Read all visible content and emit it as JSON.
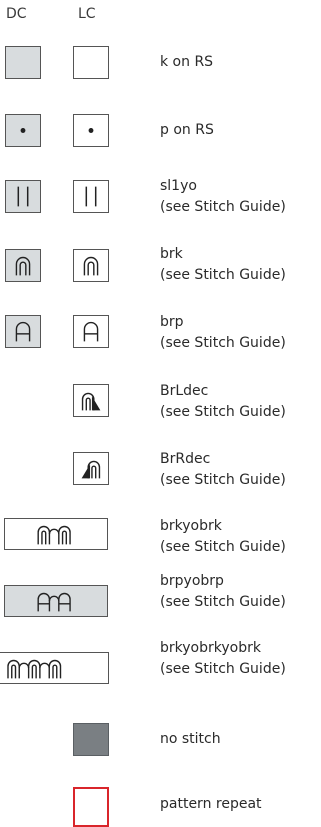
{
  "headers": {
    "dc": "DC",
    "lc": "LC"
  },
  "colors": {
    "dc_fill": "#d8dcde",
    "no_stitch": "#7a7f83",
    "repeat_border": "#d9252b",
    "stroke": "#555555"
  },
  "legend": [
    {
      "id": "k-on-rs",
      "icon": "blank-square-icon",
      "name": "k on RS",
      "note": ""
    },
    {
      "id": "p-on-rs",
      "icon": "dot-square-icon",
      "name": "p on RS",
      "note": ""
    },
    {
      "id": "sl1yo",
      "icon": "double-bar-icon",
      "name": "sl1yo",
      "note": "(see Stitch Guide)"
    },
    {
      "id": "brk",
      "icon": "arch-up-icon",
      "name": "brk",
      "note": "(see Stitch Guide)"
    },
    {
      "id": "brp",
      "icon": "arch-bar-icon",
      "name": "brp",
      "note": "(see Stitch Guide)"
    },
    {
      "id": "brldec",
      "icon": "arch-left-dec-icon",
      "name": "BrLdec",
      "note": "(see Stitch Guide)"
    },
    {
      "id": "brrdec",
      "icon": "arch-right-dec-icon",
      "name": "BrRdec",
      "note": "(see Stitch Guide)"
    },
    {
      "id": "brkyobrk",
      "icon": "brkyobrk-icon",
      "name": "brkyobrk",
      "note": "(see Stitch Guide)"
    },
    {
      "id": "brpyobrp",
      "icon": "brpyobrp-icon",
      "name": "brpyobrp",
      "note": "(see Stitch Guide)"
    },
    {
      "id": "brkyobrkyobrk",
      "icon": "brkyobrkyobrk-icon",
      "name": "brkyobrkyobrk",
      "note": "(see Stitch Guide)"
    },
    {
      "id": "no-stitch",
      "icon": "filled-square-icon",
      "name": "no stitch",
      "note": ""
    },
    {
      "id": "pattern-repeat",
      "icon": "red-outline-square-icon",
      "name": "pattern repeat",
      "note": ""
    }
  ]
}
